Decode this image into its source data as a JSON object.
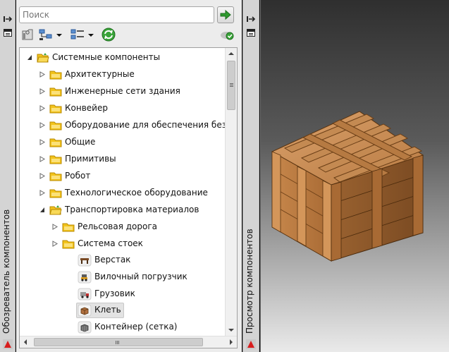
{
  "browser_panel": {
    "side_title": "Обозреватель компонентов"
  },
  "search": {
    "placeholder": "Поиск"
  },
  "toolbar": {
    "icons": [
      "folder-settings-icon",
      "tree-view-icon",
      "list-view-icon",
      "refresh-icon",
      "cloud-status-icon"
    ]
  },
  "tree": {
    "root": {
      "label": "Системные компоненты",
      "expanded": true
    },
    "categories": [
      {
        "label": "Архитектурные"
      },
      {
        "label": "Инженерные сети здания"
      },
      {
        "label": "Конвейер"
      },
      {
        "label": "Оборудование для обеспечения безопас"
      },
      {
        "label": "Общие"
      },
      {
        "label": "Примитивы"
      },
      {
        "label": "Робот"
      },
      {
        "label": "Технологическое оборудование"
      }
    ],
    "open_category": {
      "label": "Транспортировка материалов",
      "subfolders": [
        {
          "label": "Рельсовая дорога"
        },
        {
          "label": "Система стоек"
        }
      ],
      "items": [
        {
          "label": "Верстак",
          "selected": false
        },
        {
          "label": "Вилочный погрузчик",
          "selected": false
        },
        {
          "label": "Грузовик",
          "selected": false
        },
        {
          "label": "Клеть",
          "selected": true
        },
        {
          "label": "Контейнер (сетка)",
          "selected": false
        }
      ]
    }
  },
  "preview_panel": {
    "side_title": "Просмотр компонентов",
    "preview_item": "Клеть"
  },
  "colors": {
    "folder": "#f2c31b",
    "folder_edge": "#b88a00",
    "go_arrow": "#2e9b2e",
    "wood_light": "#c98a4e",
    "wood_dark": "#8a5a2c",
    "brand_red": "#d81e1e"
  }
}
